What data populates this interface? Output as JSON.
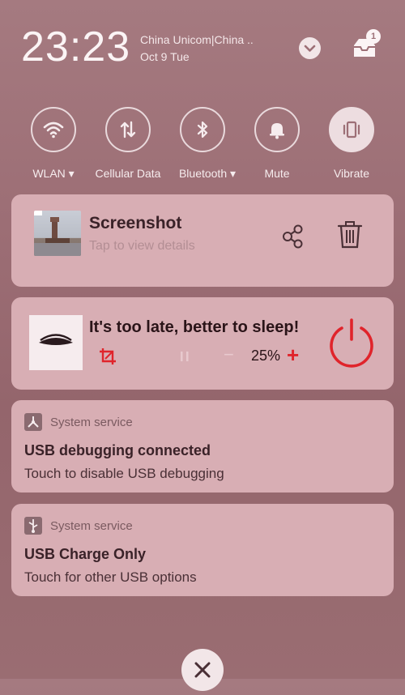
{
  "header": {
    "time": "23:23",
    "carrier": "China Unicom|China ..",
    "date": "Oct 9 Tue",
    "inbox_badge": "1"
  },
  "toggles": [
    {
      "label": "WLAN ▾",
      "icon": "wifi-icon",
      "on": false
    },
    {
      "label": "Cellular Data",
      "icon": "cellular-data-icon",
      "on": false
    },
    {
      "label": "Bluetooth ▾",
      "icon": "bluetooth-icon",
      "on": false
    },
    {
      "label": "Mute",
      "icon": "bell-icon",
      "on": false
    },
    {
      "label": "Vibrate",
      "icon": "vibrate-icon",
      "on": true
    }
  ],
  "screenshot_card": {
    "title": "Screenshot",
    "subtitle": "Tap to view details"
  },
  "sleep_card": {
    "message": "It's too late, better to sleep!",
    "brightness": "25%",
    "minus": "−",
    "plus": "+"
  },
  "usb_debug_card": {
    "source": "System service",
    "title": "USB debugging connected",
    "subtitle": "Touch to disable USB debugging"
  },
  "usb_charge_card": {
    "source": "System service",
    "title": "USB Charge Only",
    "subtitle": "Touch for other USB options"
  },
  "colors": {
    "accent_red": "#e0242b",
    "card_bg": "#d8aeb4",
    "text_dark": "#3a2228"
  }
}
